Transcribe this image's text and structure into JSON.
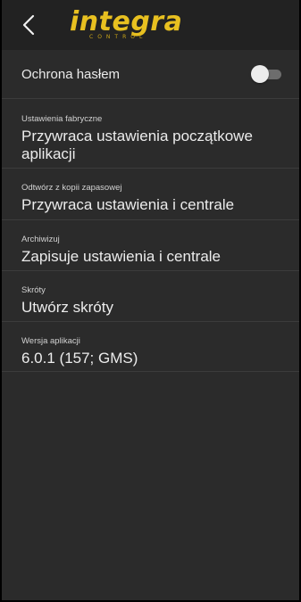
{
  "appbar": {
    "back_icon": "chevron-left-icon",
    "logo_text": "integra",
    "logo_subtext": "CONTROL",
    "logo_color": "#e8c020"
  },
  "settings": {
    "password": {
      "label": "Ochrona hasłem",
      "enabled": false
    },
    "items": [
      {
        "caption": "Ustawienia fabryczne",
        "text": "Przywraca ustawienia początkowe aplikacji"
      },
      {
        "caption": "Odtwórz z kopii zapasowej",
        "text": "Przywraca ustawienia i centrale"
      },
      {
        "caption": "Archiwizuj",
        "text": "Zapisuje ustawienia i centrale"
      },
      {
        "caption": "Skróty",
        "text": "Utwórz skróty"
      },
      {
        "caption": "Wersja aplikacji",
        "text": "6.0.1 (157; GMS)"
      }
    ]
  },
  "colors": {
    "background": "#2b2b2b",
    "appbar": "#222222",
    "text": "#eeeeee"
  }
}
